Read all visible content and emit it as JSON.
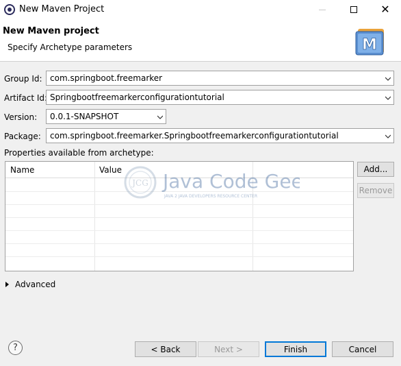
{
  "window": {
    "title": "New Maven Project",
    "close_glyph": "✕"
  },
  "header": {
    "title": "New Maven project",
    "description": "Specify Archetype parameters",
    "logo_letter": "M"
  },
  "form": {
    "group_id": {
      "label": "Group Id:",
      "value": "com.springboot.freemarker"
    },
    "artifact_id": {
      "label": "Artifact Id:",
      "value": "Springbootfreemarkerconfigurationtutorial"
    },
    "version": {
      "label": "Version:",
      "value": "0.0.1-SNAPSHOT"
    },
    "package": {
      "label": "Package:",
      "value": "com.springboot.freemarker.Springbootfreemarkerconfigurationtutorial"
    }
  },
  "properties": {
    "label": "Properties available from archetype:",
    "columns": [
      "Name",
      "Value"
    ],
    "rows": [],
    "add_label": "Add...",
    "remove_label": "Remove"
  },
  "watermark": {
    "brand": "Java Code Geeks",
    "badge": "JCG",
    "tagline": "JAVA 2 JAVA DEVELOPERS RESOURCE CENTER"
  },
  "advanced": {
    "label": "Advanced"
  },
  "footer": {
    "help_glyph": "?",
    "back_label": "< Back",
    "next_label": "Next >",
    "finish_label": "Finish",
    "cancel_label": "Cancel"
  },
  "colors": {
    "accent": "#0078d7",
    "watermark_blue": "#1f4e8c"
  }
}
